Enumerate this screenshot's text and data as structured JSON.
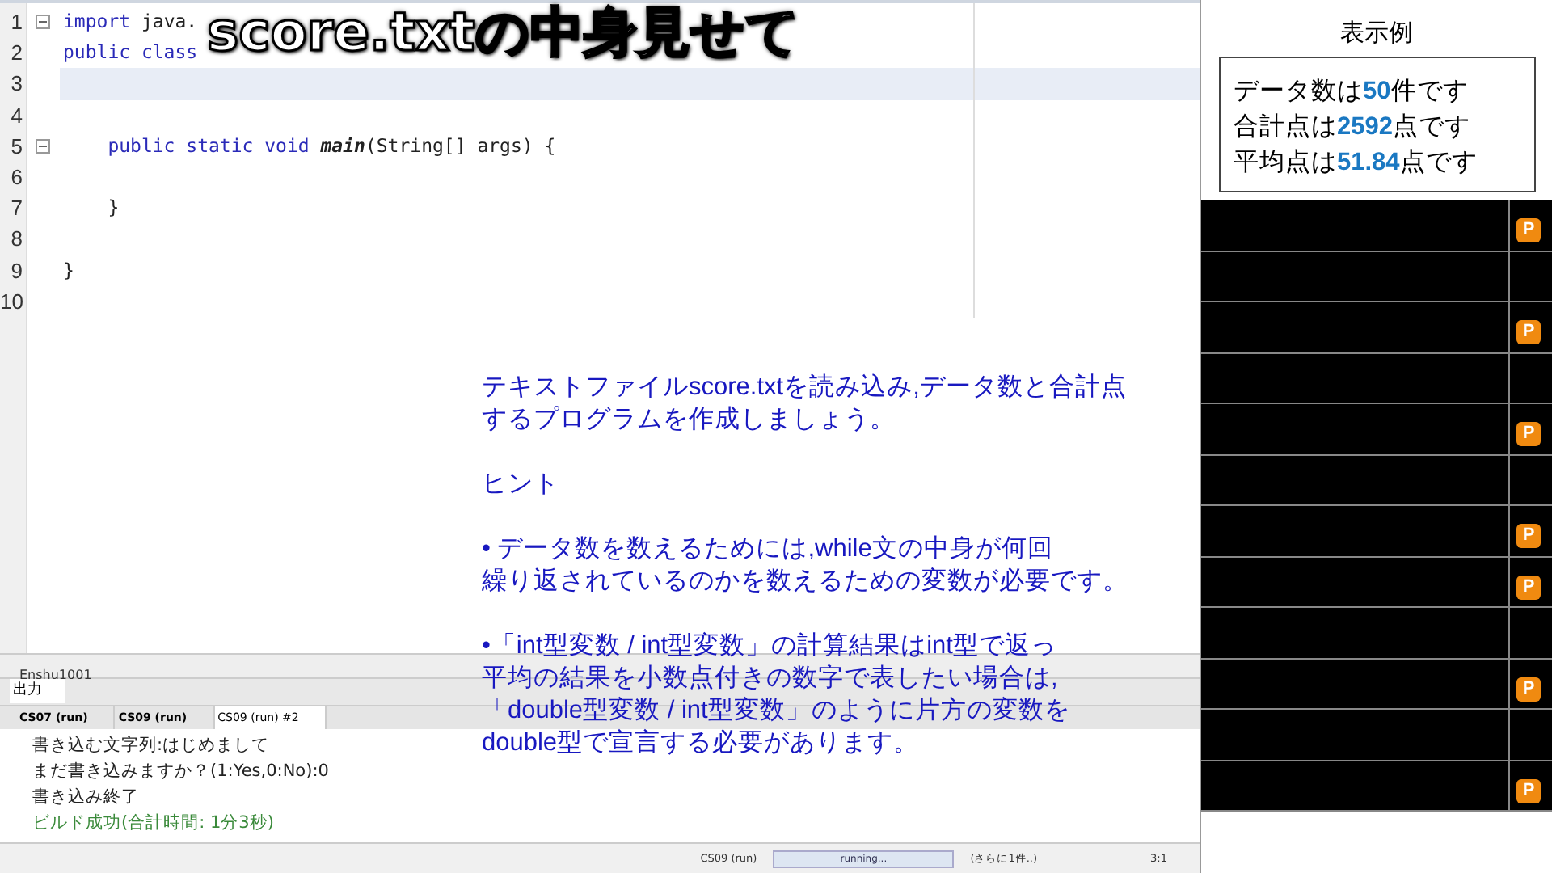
{
  "caption": "score.txtの中身見せて",
  "editor": {
    "lines": [
      {
        "number": "1",
        "fold": true,
        "current": false,
        "tokens": [
          {
            "kind": "kw",
            "text": "import"
          },
          {
            "kind": "plain",
            "text": " java."
          }
        ]
      },
      {
        "number": "2",
        "fold": false,
        "current": false,
        "tokens": [
          {
            "kind": "kw",
            "text": "public class"
          }
        ]
      },
      {
        "number": "3",
        "fold": false,
        "current": true
      },
      {
        "number": "4",
        "fold": false,
        "current": false
      },
      {
        "number": "5",
        "fold": true,
        "current": false,
        "tokens": [
          {
            "kind": "kw",
            "text": "    public static void "
          },
          {
            "kind": "italic",
            "text": "main"
          },
          {
            "kind": "plain",
            "text": "(String[] args) {"
          }
        ]
      },
      {
        "number": "6",
        "fold": false,
        "current": false
      },
      {
        "number": "7",
        "fold": false,
        "current": false,
        "tokens": [
          {
            "kind": "plain",
            "text": "    }"
          }
        ]
      },
      {
        "number": "8",
        "fold": false,
        "current": false
      },
      {
        "number": "9",
        "fold": false,
        "current": false,
        "tokens": [
          {
            "kind": "plain",
            "text": "}"
          }
        ]
      },
      {
        "number": "10",
        "fold": false,
        "current": false
      }
    ]
  },
  "breadcrumb": "Enshu1001",
  "output": {
    "title": "出力",
    "tabs": [
      {
        "label": "CS07 (run)",
        "selected": false
      },
      {
        "label": "CS09 (run)",
        "selected": false
      },
      {
        "label": "CS09 (run) #2",
        "selected": true
      }
    ],
    "lines": [
      {
        "kind": "normal",
        "text": "書き込む文字列:はじめまして"
      },
      {
        "kind": "normal",
        "text": "まだ書き込みますか？(1:Yes,0:No):0"
      },
      {
        "kind": "normal",
        "text": "書き込み終了"
      },
      {
        "kind": "success",
        "text": "ビルド成功(合計時間: 1分3秒)"
      }
    ]
  },
  "status_bar": {
    "task": "CS09 (run)",
    "progress": "running...",
    "level": 1,
    "more": "(さらに1件..)",
    "position": "3:1"
  },
  "exercise": {
    "paragraphs": [
      {
        "lines": [
          "テキストファイルscore.txtを読み込み,データ数と合計点",
          "するプログラムを作成しましょう。"
        ]
      },
      {
        "lines": [
          "ヒント"
        ]
      },
      {
        "lines": [
          "• データ数を数えるためには,while文の中身が何回",
          "繰り返されているのかを数えるための変数が必要です。"
        ]
      },
      {
        "lines": [
          "•「int型変数 / int型変数」の計算結果はint型で返っ",
          "平均の結果を小数点付きの数字で表したい場合は,",
          "「double型変数 / int型変数」のように片方の変数を",
          "double型で宣言する必要があります。"
        ]
      }
    ]
  },
  "example": {
    "title": "表示例",
    "lines": [
      "データ数は**50**件です",
      "合計点は**2592**点です",
      "平均点は**51.84**点です"
    ]
  },
  "comments": {
    "rows": [
      {
        "kind": "badge",
        "badge": "P"
      },
      {
        "kind": "plain"
      },
      {
        "kind": "badge",
        "badge": "P"
      },
      {
        "kind": "plain"
      },
      {
        "kind": "badge",
        "badge": "P"
      },
      {
        "kind": "plain"
      },
      {
        "kind": "badge",
        "badge": "P"
      },
      {
        "kind": "badge",
        "badge": "P"
      },
      {
        "kind": "plain"
      },
      {
        "kind": "badge",
        "badge": "P"
      },
      {
        "kind": "plain"
      },
      {
        "kind": "badge",
        "badge": "P"
      }
    ]
  }
}
